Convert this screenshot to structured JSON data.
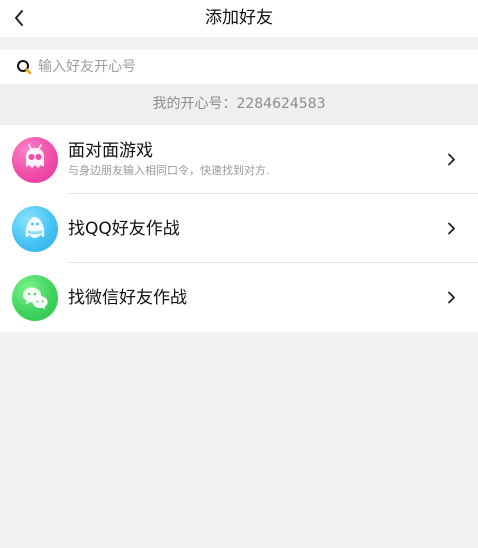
{
  "header": {
    "title": "添加好友",
    "back_icon": "chevron-left-icon"
  },
  "search": {
    "placeholder": "输入好友开心号",
    "icon": "search-icon",
    "value": ""
  },
  "my_id": {
    "text": "我的开心号：2284624583"
  },
  "items": [
    {
      "title": "面对面游戏",
      "subtitle": "与身边朋友输入相同口令，快速找到对方.",
      "icon": "ghost-icon",
      "color": "#f04da8"
    },
    {
      "title": "找QQ好友作战",
      "subtitle": "",
      "icon": "qq-penguin-icon",
      "color": "#45c2f3"
    },
    {
      "title": "找微信好友作战",
      "subtitle": "",
      "icon": "wechat-icon",
      "color": "#3fd35d"
    }
  ],
  "colors": {
    "background": "#f2f2f2",
    "header_bg": "#ffffff",
    "subtitle_gray": "#9a9a9a",
    "id_gray": "#8e8e8e"
  }
}
